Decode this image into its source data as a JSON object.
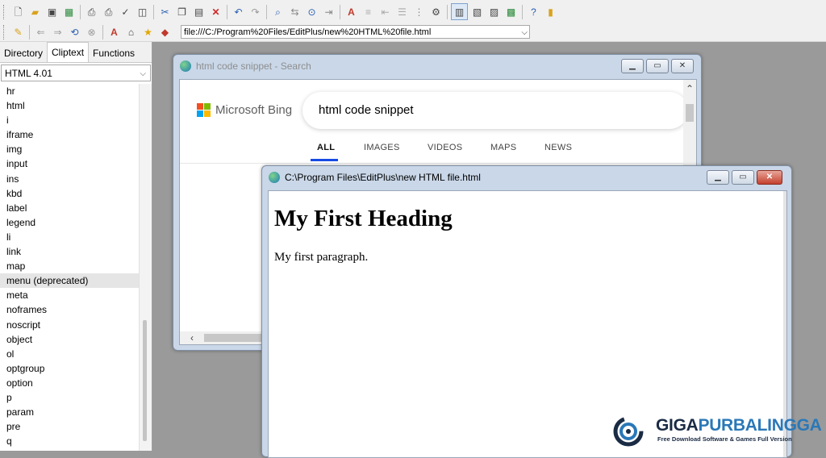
{
  "toolbar": {
    "address": "file:///C:/Program%20Files/EditPlus/new%20HTML%20file.html"
  },
  "sidebar": {
    "tabs": [
      "Directory",
      "Cliptext",
      "Functions"
    ],
    "active_tab": "Cliptext",
    "selector": "HTML 4.01",
    "items": [
      "hr",
      "html",
      "i",
      "iframe",
      "img",
      "input",
      "ins",
      "kbd",
      "label",
      "legend",
      "li",
      "link",
      "map",
      "menu (deprecated)",
      "meta",
      "noframes",
      "noscript",
      "object",
      "ol",
      "optgroup",
      "option",
      "p",
      "param",
      "pre",
      "q"
    ],
    "selected_item": "menu (deprecated)"
  },
  "browser_window": {
    "title": "html code snippet - Search",
    "logo_text": "Microsoft Bing",
    "search_query": "html code snippet",
    "nav_tabs": [
      "ALL",
      "IMAGES",
      "VIDEOS",
      "MAPS",
      "NEWS"
    ],
    "active_nav": "ALL"
  },
  "file_window": {
    "title": "C:\\Program Files\\EditPlus\\new HTML file.html",
    "heading": "My First Heading",
    "paragraph": "My first paragraph."
  },
  "watermark": {
    "brand_part1": "GIGA",
    "brand_part2": "PURBALINGGA",
    "tagline": "Free Download Software & Games Full Version"
  },
  "colors": {
    "accent_blue": "#174ae4",
    "selected_row": "#e5e5e5",
    "desktop_gray": "#9a9a9a"
  }
}
